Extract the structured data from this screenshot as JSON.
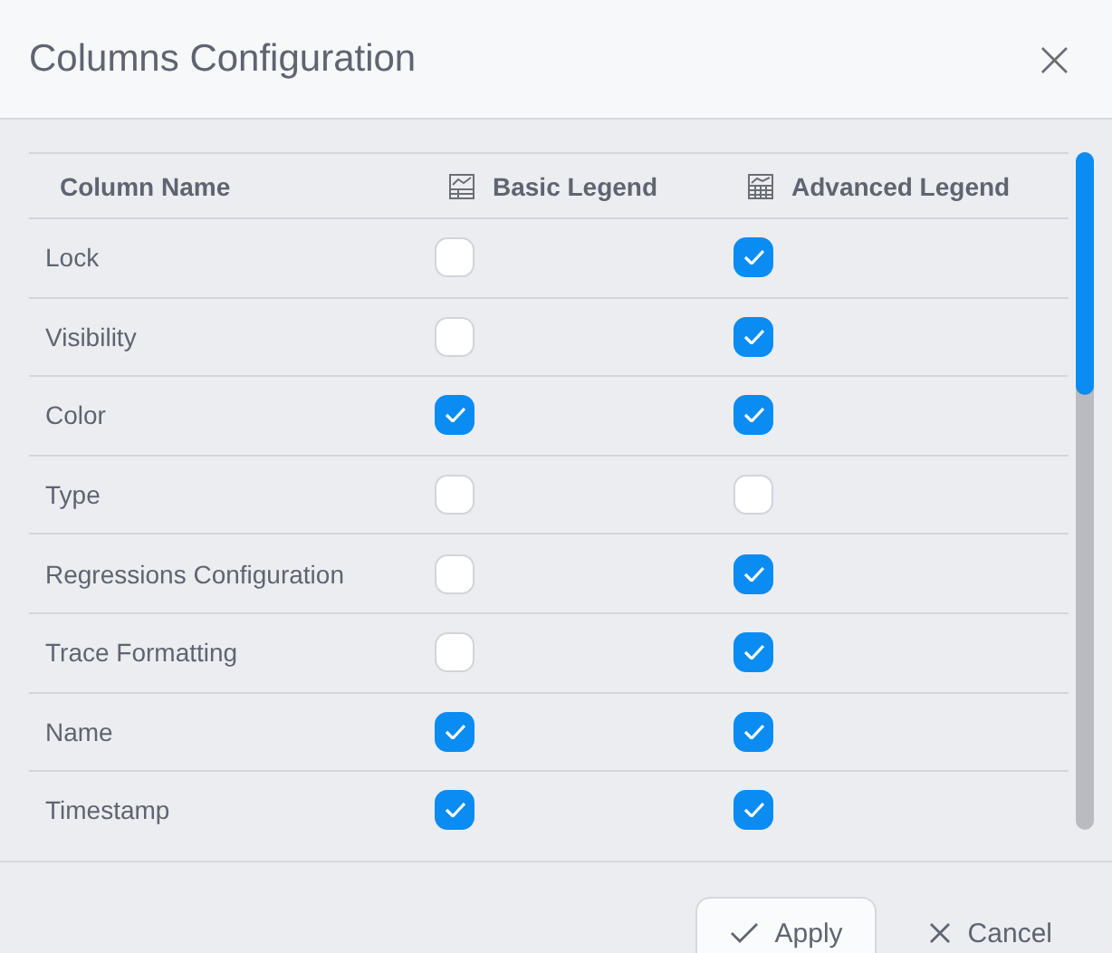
{
  "dialog": {
    "title": "Columns Configuration",
    "close": "×"
  },
  "table": {
    "columns": [
      {
        "label": "Column Name"
      },
      {
        "label": "Basic Legend"
      },
      {
        "label": "Advanced Legend"
      }
    ],
    "rows": [
      {
        "name": "Lock",
        "basic": false,
        "advanced": true
      },
      {
        "name": "Visibility",
        "basic": false,
        "advanced": true
      },
      {
        "name": "Color",
        "basic": true,
        "advanced": true
      },
      {
        "name": "Type",
        "basic": false,
        "advanced": false
      },
      {
        "name": "Regressions Configuration",
        "basic": false,
        "advanced": true
      },
      {
        "name": "Trace Formatting",
        "basic": false,
        "advanced": true
      },
      {
        "name": "Name",
        "basic": true,
        "advanced": true
      },
      {
        "name": "Timestamp",
        "basic": true,
        "advanced": true
      }
    ]
  },
  "buttons": [
    {
      "kind": "apply",
      "label": "Apply"
    },
    {
      "kind": "cancel",
      "label": "Cancel"
    }
  ]
}
